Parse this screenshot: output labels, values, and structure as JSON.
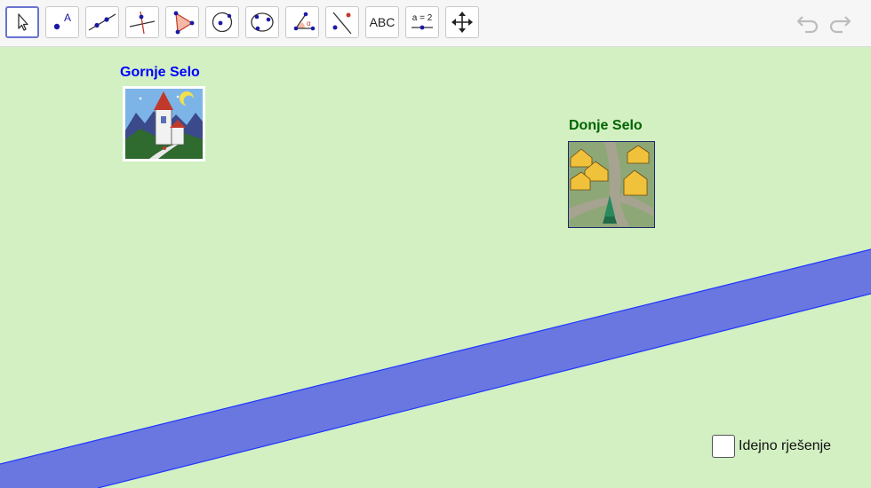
{
  "toolbar": {
    "tools": [
      {
        "name": "move-tool-icon",
        "selected": true
      },
      {
        "name": "point-tool-icon"
      },
      {
        "name": "line-tool-icon"
      },
      {
        "name": "perpendicular-line-tool-icon"
      },
      {
        "name": "polygon-tool-icon"
      },
      {
        "name": "circle-center-tool-icon"
      },
      {
        "name": "circle-three-points-tool-icon"
      },
      {
        "name": "angle-tool-icon"
      },
      {
        "name": "reflect-tool-icon"
      },
      {
        "name": "text-tool-icon",
        "label": "ABC"
      },
      {
        "name": "slider-tool-icon",
        "label": "a = 2"
      },
      {
        "name": "move-graphics-view-tool-icon"
      }
    ],
    "undo_icon": "undo-icon",
    "redo_icon": "redo-icon",
    "point_label": "A"
  },
  "canvas": {
    "village_upper": {
      "label": "Gornje Selo",
      "color": "#0000ff"
    },
    "village_lower": {
      "label": "Donje Selo",
      "color": "#006400"
    },
    "river_color": "#6a77e0",
    "background": "#d2f0c2",
    "checkbox": {
      "label": "Idejno rješenje",
      "checked": false
    }
  }
}
